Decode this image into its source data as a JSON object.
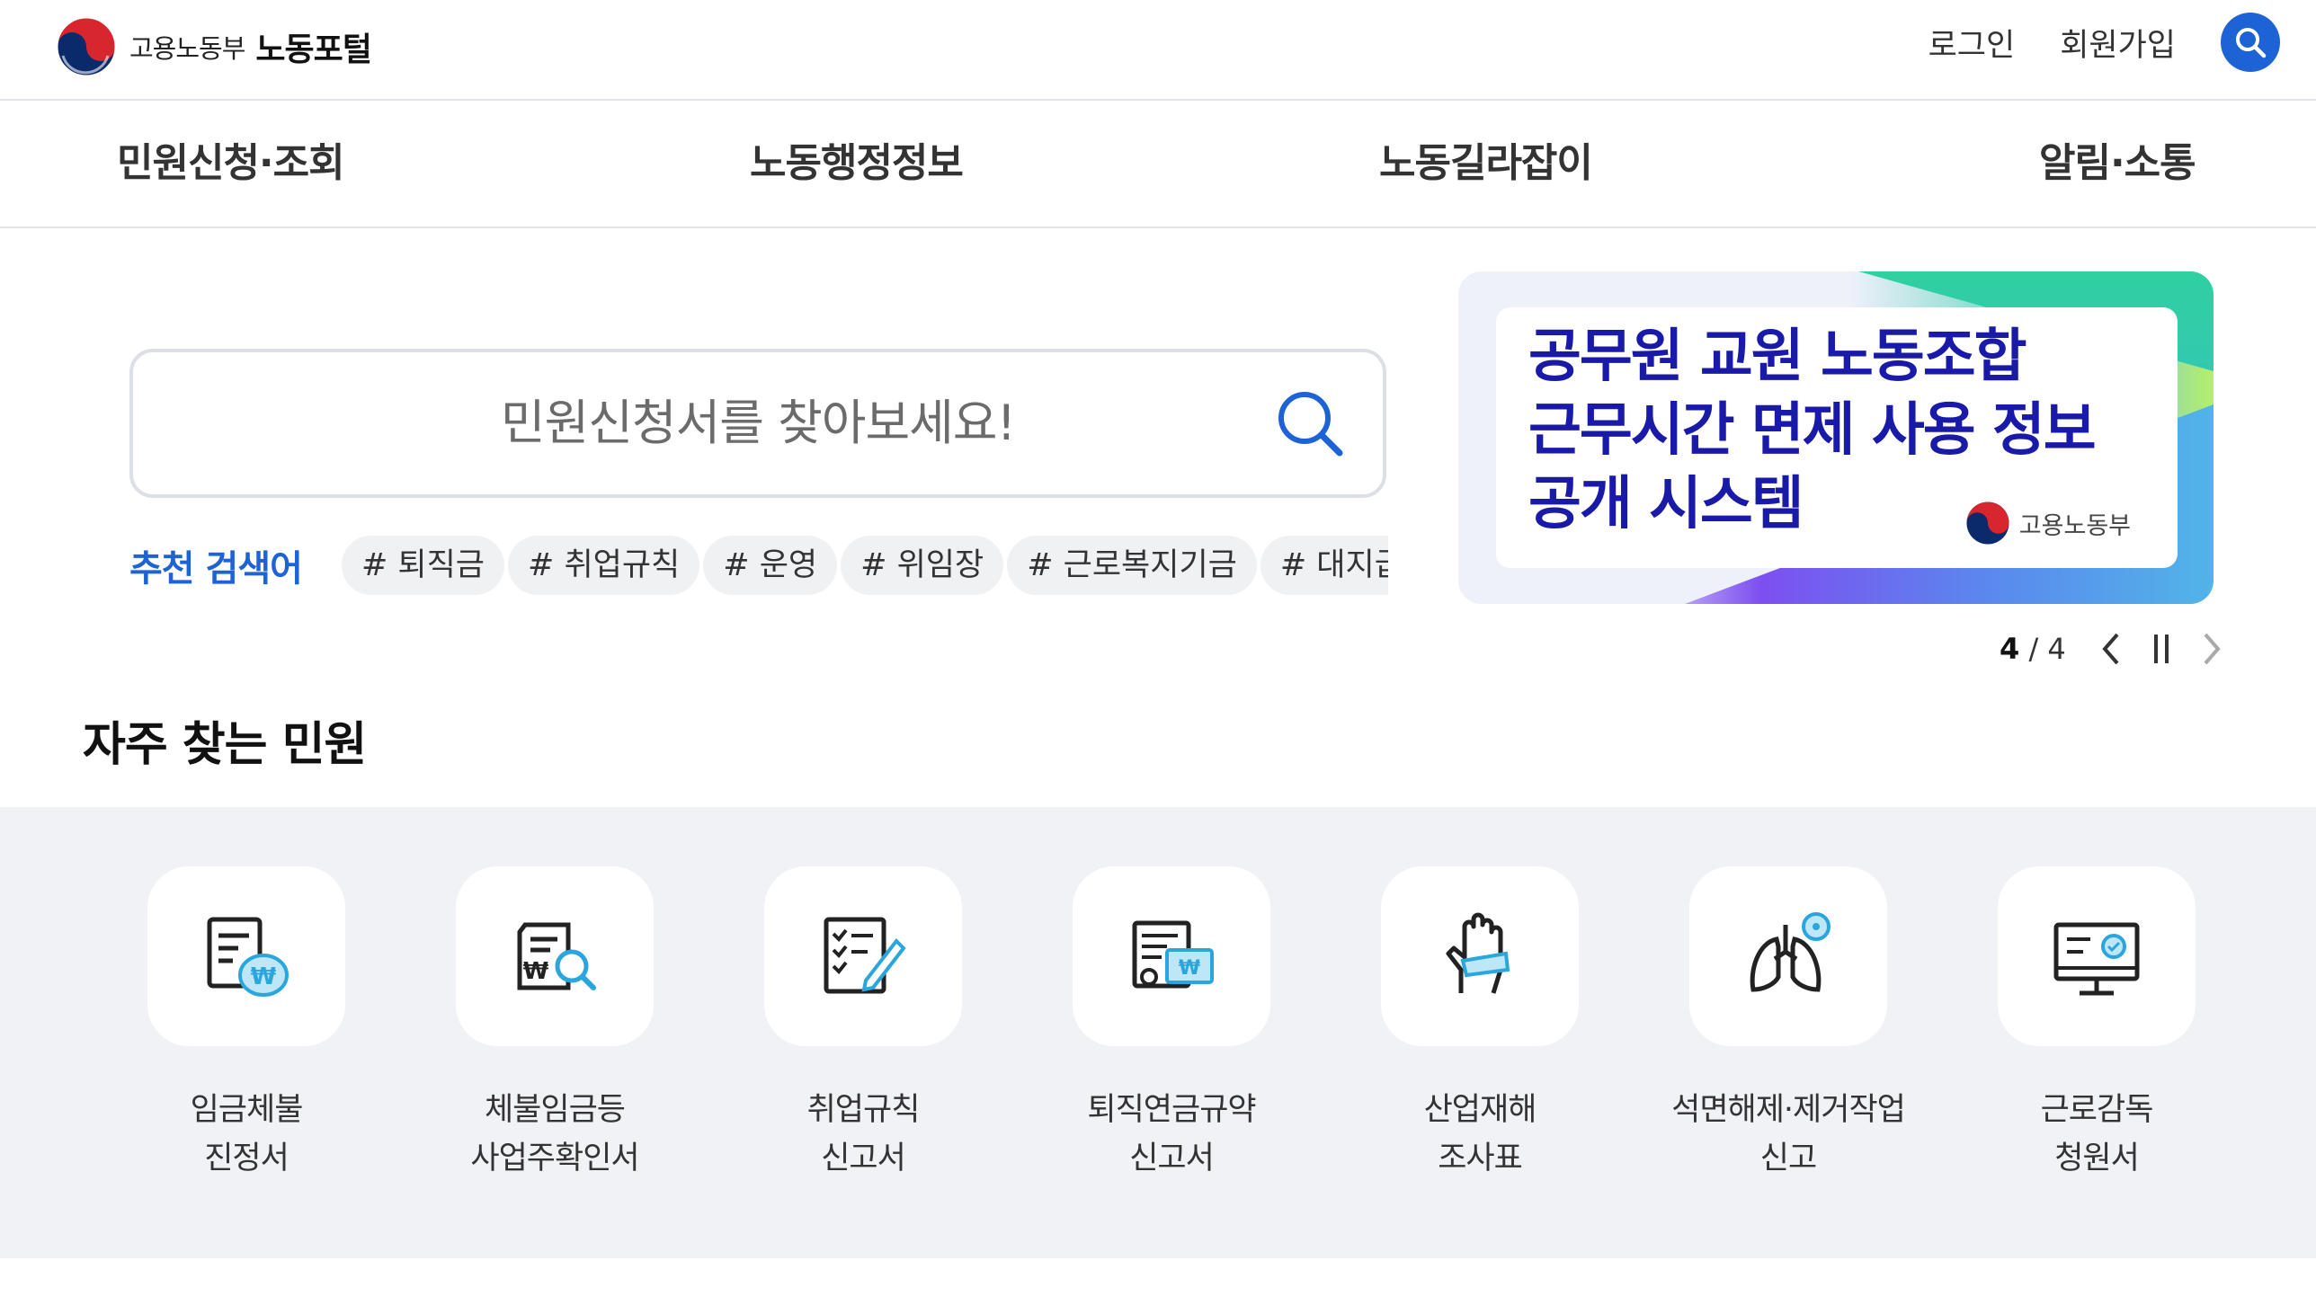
{
  "header": {
    "ministry": "고용노동부",
    "portal": "노동포털",
    "login": "로그인",
    "signup": "회원가입"
  },
  "gnb": [
    "민원신청·조회",
    "노동행정정보",
    "노동길라잡이",
    "알림·소통"
  ],
  "search": {
    "placeholder": "민원신청서를 찾아보세요!",
    "recommend_label": "추천 검색어",
    "keywords": [
      "# 퇴직금",
      "# 취업규칙",
      "# 운영",
      "# 위임장",
      "# 근로복지기금",
      "# 대지급금"
    ]
  },
  "banner": {
    "lines": [
      "공무원 교원 노동조합",
      "근무시간 면제 사용 정보",
      "공개 시스템"
    ],
    "ministry": "고용노동부",
    "current": "4",
    "total": "/ 4"
  },
  "frequent": {
    "title": "자주 찾는 민원",
    "items": [
      {
        "line1": "임금체불",
        "line2": "진정서",
        "icon": "wage-bag-icon"
      },
      {
        "line1": "체불임금등",
        "line2": "사업주확인서",
        "icon": "document-search-icon"
      },
      {
        "line1": "취업규칙",
        "line2": "신고서",
        "icon": "checklist-pen-icon"
      },
      {
        "line1": "퇴직연금규약",
        "line2": "신고서",
        "icon": "certificate-icon"
      },
      {
        "line1": "산업재해",
        "line2": "조사표",
        "icon": "injured-hand-icon"
      },
      {
        "line1": "석면해제·제거작업",
        "line2": "신고",
        "icon": "lungs-icon"
      },
      {
        "line1": "근로감독",
        "line2": "청원서",
        "icon": "monitor-check-icon"
      }
    ]
  },
  "colors": {
    "accent": "#1e63d6",
    "banner_text": "#1a1aa8",
    "section_bg": "#f1f2f5"
  }
}
